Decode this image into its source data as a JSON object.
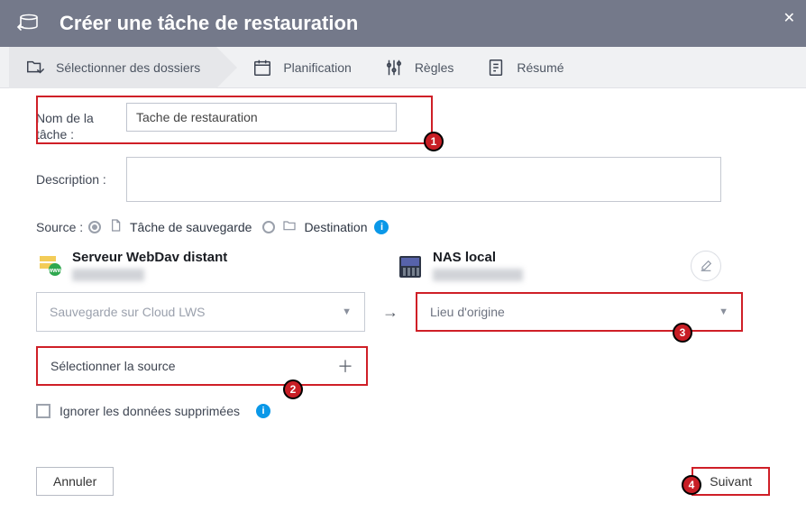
{
  "header": {
    "title": "Créer une tâche de restauration",
    "close": "✕"
  },
  "wizard": {
    "select": "Sélectionner des dossiers",
    "plan": "Planification",
    "rules": "Règles",
    "summary": "Résumé"
  },
  "labels": {
    "task_name": "Nom de la tâche :",
    "description": "Description :",
    "source": "Source :",
    "backup_task": "Tâche de sauvegarde",
    "destination": "Destination",
    "select_source": "Sélectionner la source",
    "origin": "Lieu d'origine",
    "ignore": "Ignorer les données supprimées",
    "backup_on_lws": "Sauvegarde sur Cloud LWS"
  },
  "endpoints": {
    "left_title": "Serveur WebDav distant",
    "right_title": "NAS local"
  },
  "values": {
    "task_name": "Tache de restauration"
  },
  "buttons": {
    "cancel": "Annuler",
    "next": "Suivant"
  },
  "annotations": {
    "b1": "1",
    "b2": "2",
    "b3": "3",
    "b4": "4"
  }
}
